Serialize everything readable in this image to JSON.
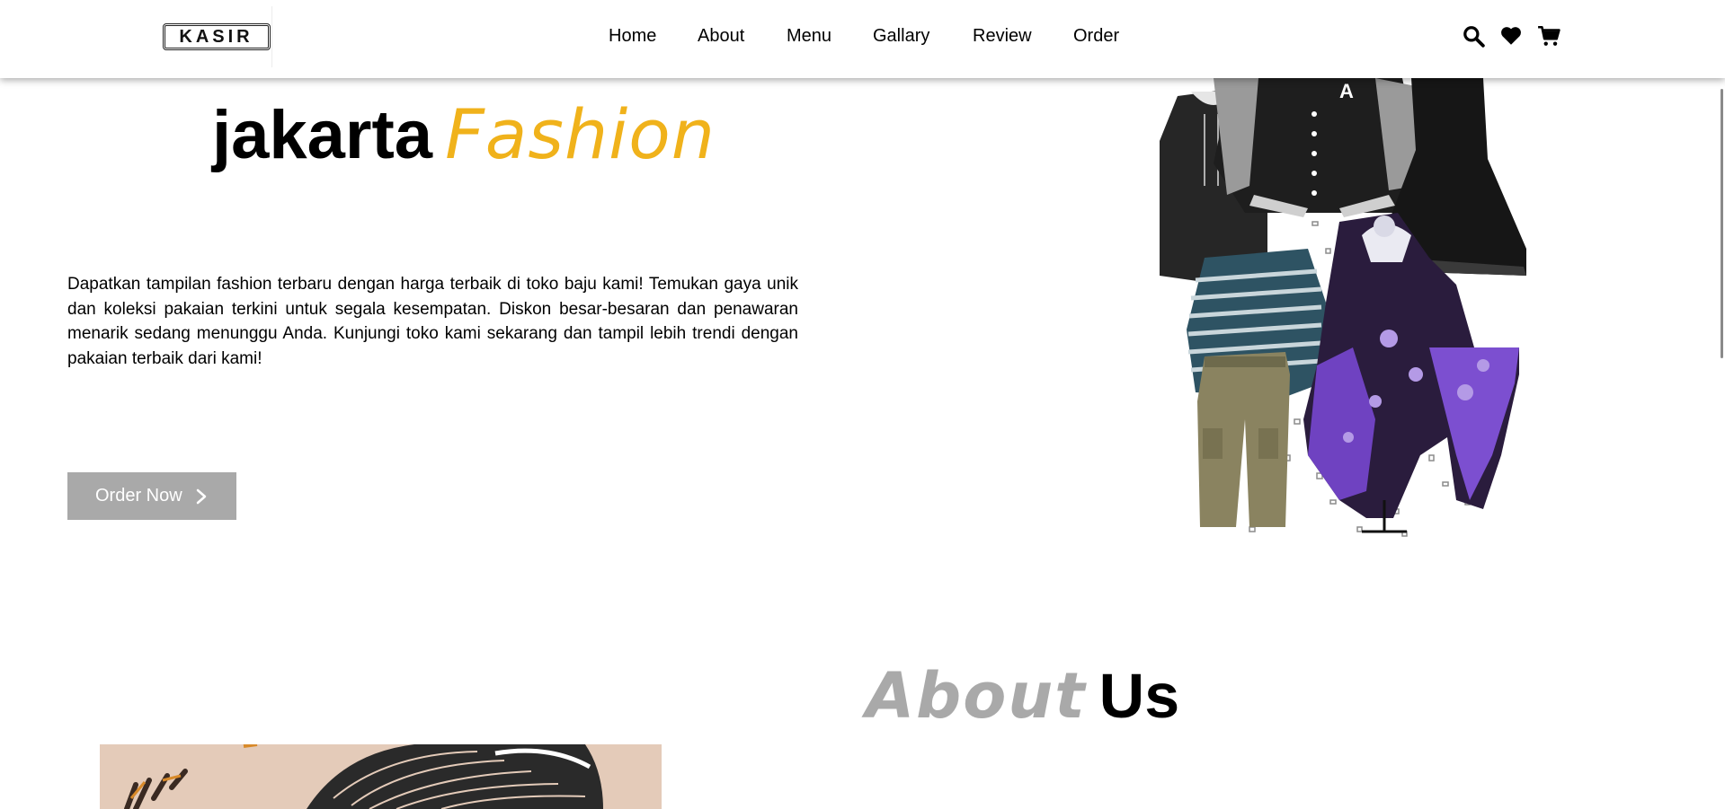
{
  "logo": {
    "text": "KASIR"
  },
  "nav": {
    "links": [
      {
        "label": "Home"
      },
      {
        "label": "About"
      },
      {
        "label": "Menu"
      },
      {
        "label": "Gallary"
      },
      {
        "label": "Review"
      },
      {
        "label": "Order"
      }
    ],
    "icons": [
      "search-icon",
      "heart-icon",
      "cart-icon"
    ]
  },
  "hero": {
    "title_main": "jakarta",
    "title_accent": "Fashion",
    "description": "Dapatkan tampilan fashion terbaru dengan harga terbaik di toko baju kami! Temukan gaya unik dan koleksi pakaian terkini untuk segala kesempatan. Diskon besar-besaran dan penawaran menarik sedang menunggu Anda. Kunjungi toko kami sekarang dan tampil lebih trendi dengan pakaian terbaik dari kami!",
    "button_label": "Order Now"
  },
  "about": {
    "title_grey": "About",
    "title_dark": "Us"
  },
  "colors": {
    "accent": "#f0b21b",
    "button_bg": "#a9a9a9",
    "about_grey": "#a9a9a9"
  }
}
